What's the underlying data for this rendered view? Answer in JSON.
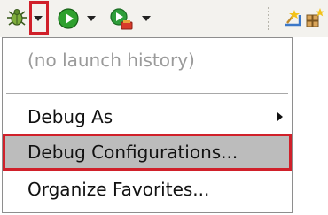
{
  "toolbar": {
    "items": [
      {
        "name": "debug-button",
        "icon": "bug-icon"
      },
      {
        "name": "debug-dropdown",
        "icon": "chevron-down-icon"
      },
      {
        "name": "run-button",
        "icon": "play-icon"
      },
      {
        "name": "run-dropdown",
        "icon": "chevron-down-icon"
      },
      {
        "name": "external-tools-button",
        "icon": "external-tools-icon"
      },
      {
        "name": "external-tools-dropdown",
        "icon": "chevron-down-icon"
      },
      {
        "name": "new-project-button",
        "icon": "new-project-icon"
      },
      {
        "name": "new-package-button",
        "icon": "new-package-icon"
      }
    ]
  },
  "menu": {
    "no_history": "(no launch history)",
    "debug_as": "Debug As",
    "debug_configurations": "Debug Configurations...",
    "organize_favorites": "Organize Favorites..."
  },
  "colors": {
    "highlight_border": "#d0202a",
    "hover_background": "#bcbcbc",
    "toolbar_background": "#f3f2ee",
    "disabled_text": "#9a9a9a"
  }
}
